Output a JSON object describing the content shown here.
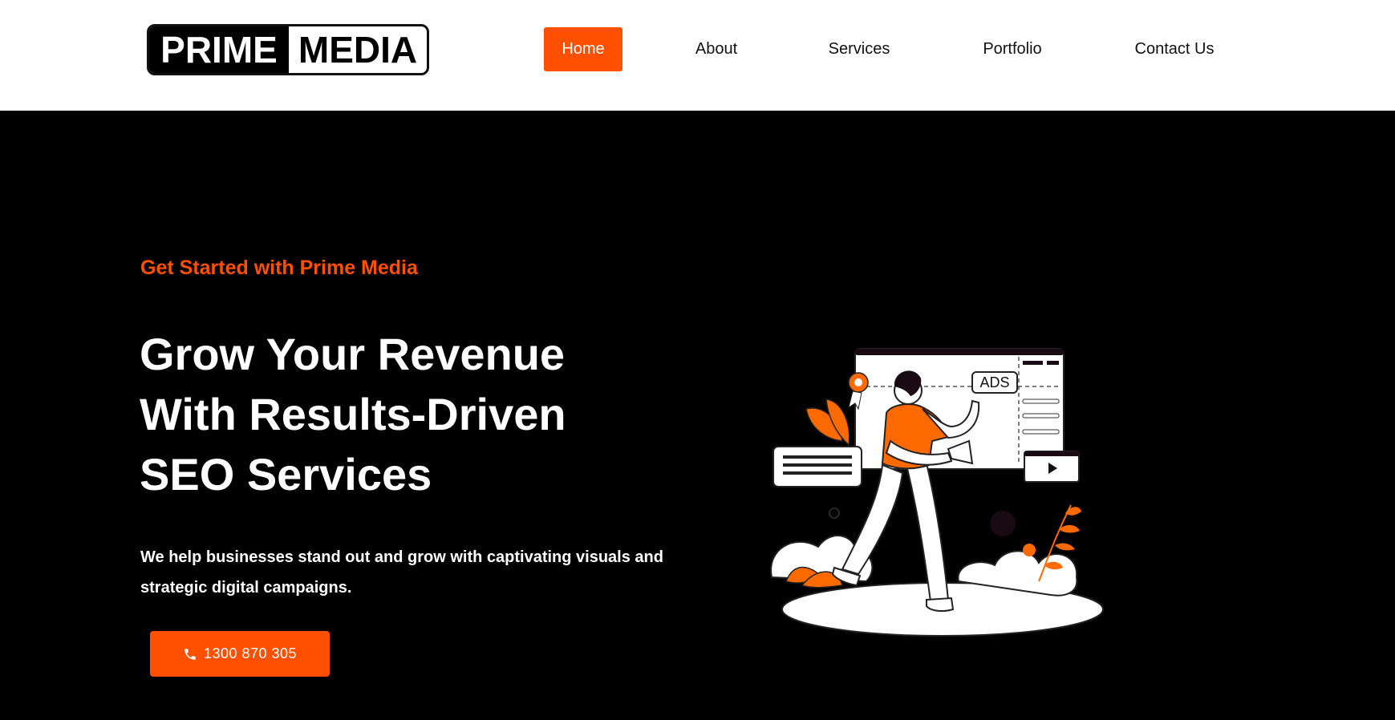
{
  "brand": {
    "logo_left": "PRIME",
    "logo_right": "MEDIA"
  },
  "nav": {
    "items": [
      {
        "label": "Home",
        "active": true
      },
      {
        "label": "About",
        "active": false
      },
      {
        "label": "Services",
        "active": false
      },
      {
        "label": "Portfolio",
        "active": false
      },
      {
        "label": "Contact Us",
        "active": false
      }
    ]
  },
  "hero": {
    "eyebrow": "Get Started with Prime Media",
    "title_lines": [
      "Grow Your Revenue",
      "With Results-Driven",
      "SEO Services"
    ],
    "description": "We help businesses stand out and grow with captivating visuals and strategic digital campaigns.",
    "cta_label": "1300 870 305",
    "cta_icon": "phone-icon"
  },
  "illustration": {
    "ads_label": "ADS"
  },
  "colors": {
    "accent": "#ff5000",
    "background": "#000000",
    "header": "#ffffff"
  }
}
